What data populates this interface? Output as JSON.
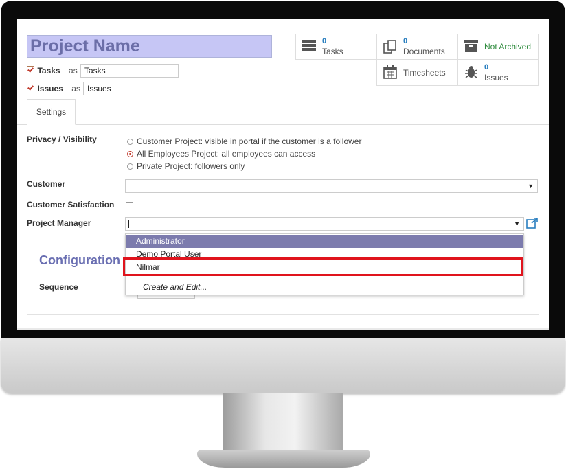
{
  "project": {
    "name": "Project Name"
  },
  "aliases": [
    {
      "label": "Tasks",
      "as": "as",
      "value": "Tasks",
      "checked": true
    },
    {
      "label": "Issues",
      "as": "as",
      "value": "Issues",
      "checked": true
    }
  ],
  "stats": {
    "tasks": {
      "count": "0",
      "label": "Tasks",
      "icon": "tasks-list-icon"
    },
    "documents": {
      "count": "0",
      "label": "Documents",
      "icon": "documents-icon"
    },
    "archive": {
      "label": "Not Archived",
      "icon": "archive-box-icon",
      "color": "#2e8b3d"
    },
    "timesheets": {
      "label": "Timesheets",
      "icon": "calendar-icon"
    },
    "issues": {
      "count": "0",
      "label": "Issues",
      "icon": "bug-icon"
    }
  },
  "tabs": [
    {
      "label": "Settings"
    }
  ],
  "fields": {
    "privacy": {
      "label": "Privacy / Visibility",
      "options": [
        {
          "label": "Customer Project: visible in portal if the customer is a follower",
          "selected": false
        },
        {
          "label": "All Employees Project: all employees can access",
          "selected": true
        },
        {
          "label": "Private Project: followers only",
          "selected": false
        }
      ]
    },
    "customer": {
      "label": "Customer",
      "value": ""
    },
    "customer_satisfaction": {
      "label": "Customer Satisfaction",
      "checked": false
    },
    "project_manager": {
      "label": "Project Manager",
      "value": ""
    }
  },
  "dropdown": {
    "items": [
      {
        "label": "Administrator",
        "active": true
      },
      {
        "label": "Demo Portal User",
        "active": false
      },
      {
        "label": "Nilmar",
        "active": false,
        "highlighted": true
      },
      {
        "label": "Create and Edit...",
        "active": false,
        "italic": true
      }
    ]
  },
  "configuration": {
    "title": "Configuration",
    "sequence_label": "Sequence"
  },
  "colors": {
    "accent": "#7c7bad",
    "highlight": "#e0141d",
    "link": "#2a7fbf"
  }
}
